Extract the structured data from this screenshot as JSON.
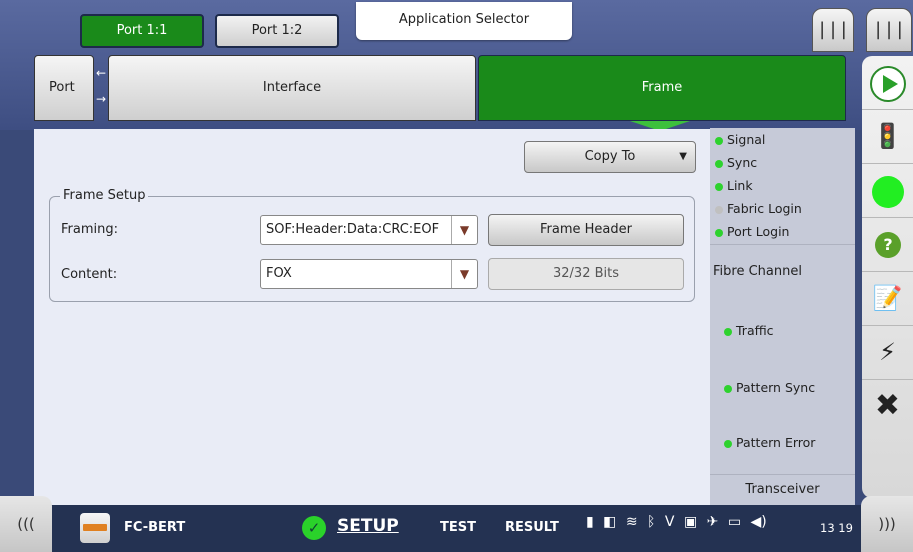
{
  "header": {
    "port_tabs": [
      {
        "label": "Port 1:1",
        "active": true
      },
      {
        "label": "Port 1:2",
        "active": false
      }
    ],
    "app_selector": "Application Selector",
    "menu_button_a_icon": "list-menu-icon",
    "menu_button_b_icon": "list-menu-icon"
  },
  "nav": {
    "port": "Port",
    "interface": "Interface",
    "frame": "Frame",
    "active_color": "#1a8a1a"
  },
  "main": {
    "copy_to": "Copy To",
    "group_title": "Frame Setup",
    "framing_label": "Framing:",
    "framing_value": "SOF:Header:Data:CRC:EOF",
    "frame_header_button": "Frame Header",
    "content_label": "Content:",
    "content_value": "FOX",
    "bits_button": "32/32 Bits"
  },
  "status": {
    "leds": [
      {
        "label": "Signal",
        "on": true
      },
      {
        "label": "Sync",
        "on": true
      },
      {
        "label": "Link",
        "on": true
      },
      {
        "label": "Fabric Login",
        "on": false
      },
      {
        "label": "Port Login",
        "on": true
      }
    ],
    "title": "Fibre Channel",
    "items": [
      {
        "label": "Traffic",
        "on": true
      },
      {
        "label": "Pattern Sync",
        "on": true
      },
      {
        "label": "Pattern Error",
        "on": true
      }
    ],
    "transceiver": "Transceiver",
    "led_on_color": "#2ed22e"
  },
  "right_toolbar": {
    "icons": [
      "play-icon",
      "traffic-light-icon",
      "status-green-icon",
      "help-icon",
      "report-icon",
      "inject-error-icon",
      "close-icon"
    ]
  },
  "bottom": {
    "collapse_left": "(((",
    "collapse_right": ")))",
    "app_name": "FC-BERT",
    "tab_setup": "SETUP",
    "tab_test": "TEST",
    "tab_result": "RESULT",
    "clock": "13 19"
  }
}
